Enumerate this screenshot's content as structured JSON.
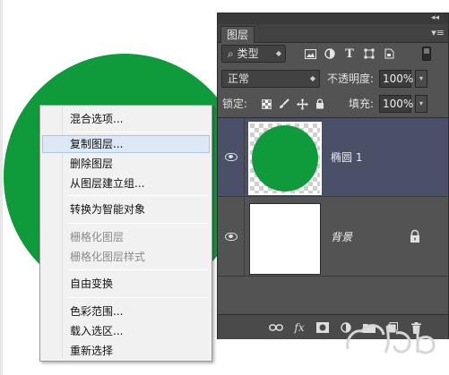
{
  "colors": {
    "circle_fill": "#0f9a3c",
    "panel_bg": "#535353",
    "selected_layer": "#4a5068",
    "menu_bg": "#f1f1f1"
  },
  "context_menu": {
    "items": [
      {
        "label": "混合选项...",
        "enabled": true
      },
      {
        "label": "复制图层...",
        "enabled": true,
        "highlighted": true
      },
      {
        "label": "删除图层",
        "enabled": true
      },
      {
        "label": "从图层建立组...",
        "enabled": true
      },
      {
        "label": "转换为智能对象",
        "enabled": true
      },
      {
        "label": "栅格化图层",
        "enabled": false
      },
      {
        "label": "栅格化图层样式",
        "enabled": false
      },
      {
        "label": "自由变换",
        "enabled": true
      },
      {
        "label": "色彩范围...",
        "enabled": true
      },
      {
        "label": "载入选区...",
        "enabled": true
      },
      {
        "label": "重新选择",
        "enabled": true
      }
    ]
  },
  "layers_panel": {
    "tab_label": "图层",
    "collapse_icon": "double-chevron-left-icon",
    "menu_icon": "panel-menu-icon",
    "filter": {
      "icon": "search-icon",
      "selected": "类型"
    },
    "filter_icons": [
      "image-filter-icon",
      "adjustment-filter-icon",
      "type-filter-icon",
      "shape-filter-icon",
      "smart-object-filter-icon"
    ],
    "blend_mode": "正常",
    "opacity_label": "不透明度:",
    "opacity_value": "100%",
    "lock_label": "锁定:",
    "lock_icons": [
      "lock-transparent-icon",
      "lock-paint-icon",
      "lock-position-icon",
      "lock-all-icon"
    ],
    "fill_label": "填充:",
    "fill_value": "100%",
    "layers": [
      {
        "name": "椭圆 1",
        "visible": true,
        "selected": true
      },
      {
        "name": "背景",
        "visible": true,
        "selected": false,
        "locked": true
      }
    ],
    "bottom_icons": [
      "link-layers-icon",
      "fx-icon",
      "add-mask-icon",
      "adjustment-layer-icon",
      "new-group-icon",
      "new-layer-icon",
      "trash-icon"
    ]
  },
  "footer": {
    "fx_glyph": "fx",
    "watermark": "Baidu watermark"
  }
}
